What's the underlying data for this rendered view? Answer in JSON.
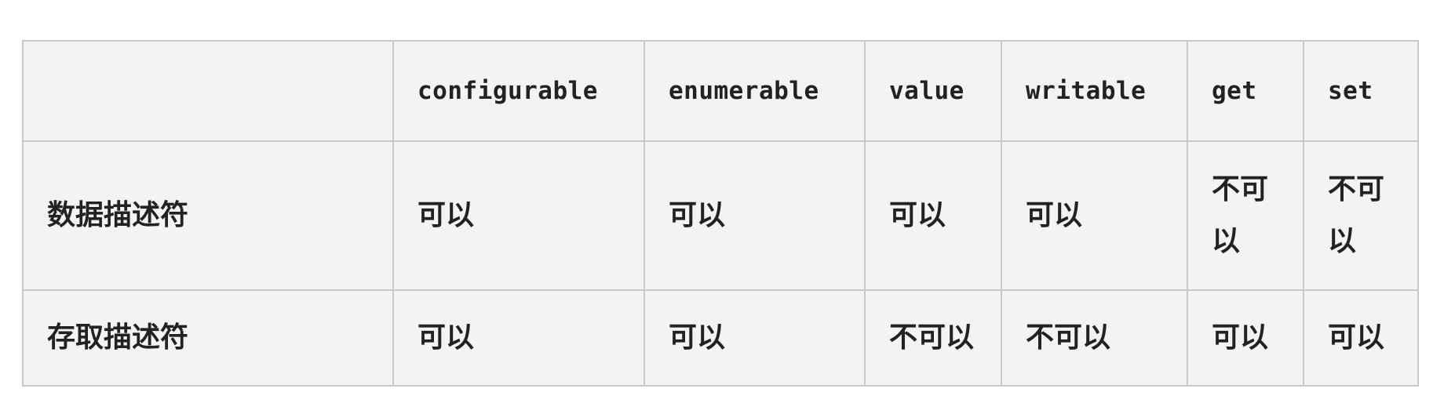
{
  "table": {
    "headers": [
      "",
      "configurable",
      "enumerable",
      "value",
      "writable",
      "get",
      "set"
    ],
    "rows": [
      {
        "label": "数据描述符",
        "configurable": "可以",
        "enumerable": "可以",
        "value": "可以",
        "writable": "可以",
        "get": "不可以",
        "set": "不可以"
      },
      {
        "label": "存取描述符",
        "configurable": "可以",
        "enumerable": "可以",
        "value": "不可以",
        "writable": "不可以",
        "get": "可以",
        "set": "可以"
      }
    ]
  }
}
